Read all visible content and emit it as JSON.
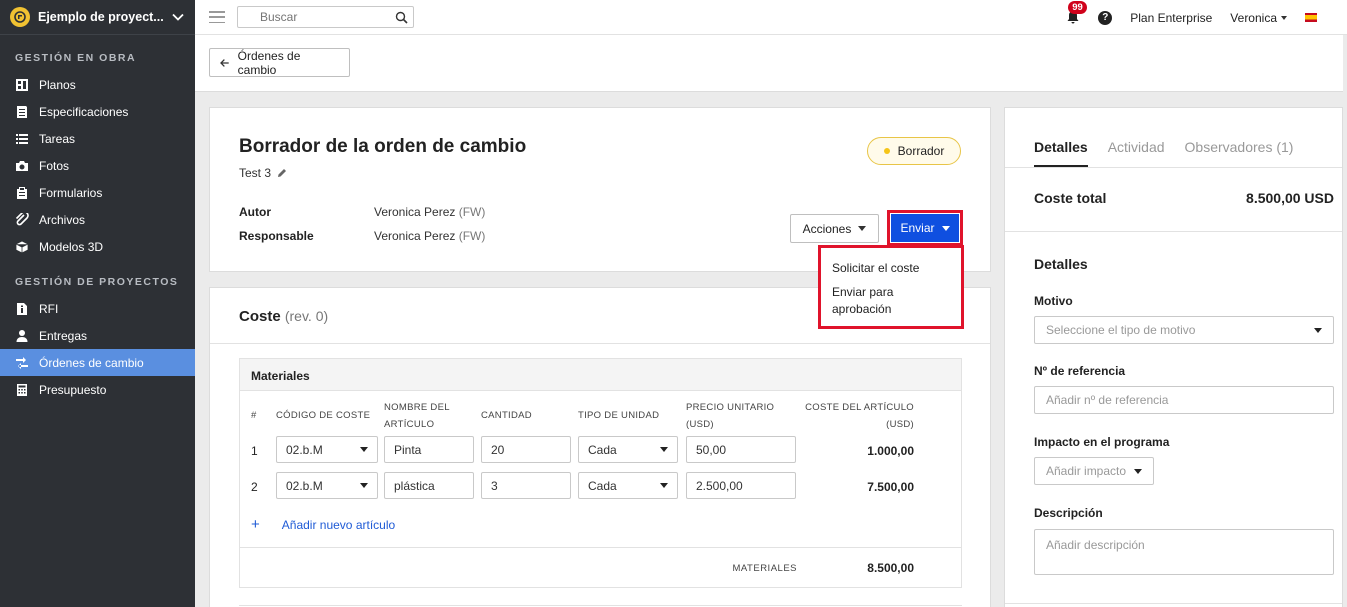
{
  "sidebar": {
    "project_name": "Ejemplo de proyect...",
    "sections": [
      {
        "title": "GESTIÓN EN OBRA",
        "items": [
          {
            "label": "Planos",
            "icon": "plans-icon"
          },
          {
            "label": "Especificaciones",
            "icon": "specifications-icon"
          },
          {
            "label": "Tareas",
            "icon": "tasks-icon"
          },
          {
            "label": "Fotos",
            "icon": "camera-icon"
          },
          {
            "label": "Formularios",
            "icon": "forms-icon"
          },
          {
            "label": "Archivos",
            "icon": "paperclip-icon"
          },
          {
            "label": "Modelos 3D",
            "icon": "cube-icon"
          }
        ]
      },
      {
        "title": "GESTIÓN DE PROYECTOS",
        "items": [
          {
            "label": "RFI",
            "icon": "rfi-icon"
          },
          {
            "label": "Entregas",
            "icon": "person-icon"
          },
          {
            "label": "Órdenes de cambio",
            "icon": "change-orders-icon",
            "active": true
          },
          {
            "label": "Presupuesto",
            "icon": "calculator-icon"
          }
        ]
      }
    ]
  },
  "topbar": {
    "search_placeholder": "Buscar",
    "notifications_count": "99",
    "help": "?",
    "plan": "Plan Enterprise",
    "user": "Veronica"
  },
  "header": {
    "back_label": "Órdenes de cambio"
  },
  "order": {
    "title": "Borrador de la orden de cambio",
    "subtitle": "Test 3",
    "status": "Borrador",
    "author_label": "Autor",
    "author_value": "Veronica Perez",
    "author_tag": "(FW)",
    "responsible_label": "Responsable",
    "responsible_value": "Veronica Perez",
    "responsible_tag": "(FW)",
    "actions_label": "Acciones",
    "send_label": "Enviar",
    "send_menu": [
      "Solicitar el coste",
      "Enviar para aprobación"
    ]
  },
  "cost": {
    "title": "Coste",
    "revision": "(rev. 0)",
    "materials_title": "Materiales",
    "columns": {
      "num": "#",
      "cost_code": "CÓDIGO DE COSTE",
      "item_name_1": "NOMBRE DEL",
      "item_name_2": "ARTÍCULO",
      "quantity": "CANTIDAD",
      "unit_type": "TIPO DE UNIDAD",
      "unit_price_1": "PRECIO UNITARIO",
      "unit_price_2": "(USD)",
      "item_cost_1": "COSTE DEL ARTÍCULO",
      "item_cost_2": "(USD)"
    },
    "rows": [
      {
        "num": "1",
        "code": "02.b.M",
        "name": "Pinta",
        "qty": "20",
        "unit": "Cada",
        "price": "50,00",
        "cost": "1.000,00"
      },
      {
        "num": "2",
        "code": "02.b.M",
        "name": "plástica",
        "qty": "3",
        "unit": "Cada",
        "price": "2.500,00",
        "cost": "7.500,00"
      }
    ],
    "add_label": "Añadir nuevo artículo",
    "total_label": "MATERIALES",
    "total_value": "8.500,00"
  },
  "panel": {
    "tabs": [
      "Detalles",
      "Actividad",
      "Observadores (1)"
    ],
    "total_label": "Coste total",
    "total_value": "8.500,00 USD",
    "details_title": "Detalles",
    "reason_label": "Motivo",
    "reason_placeholder": "Seleccione el tipo de motivo",
    "ref_label": "Nº de referencia",
    "ref_placeholder": "Añadir nº de referencia",
    "impact_label": "Impacto en el programa",
    "impact_placeholder": "Añadir impacto",
    "desc_label": "Descripción",
    "desc_placeholder": "Añadir descripción"
  }
}
